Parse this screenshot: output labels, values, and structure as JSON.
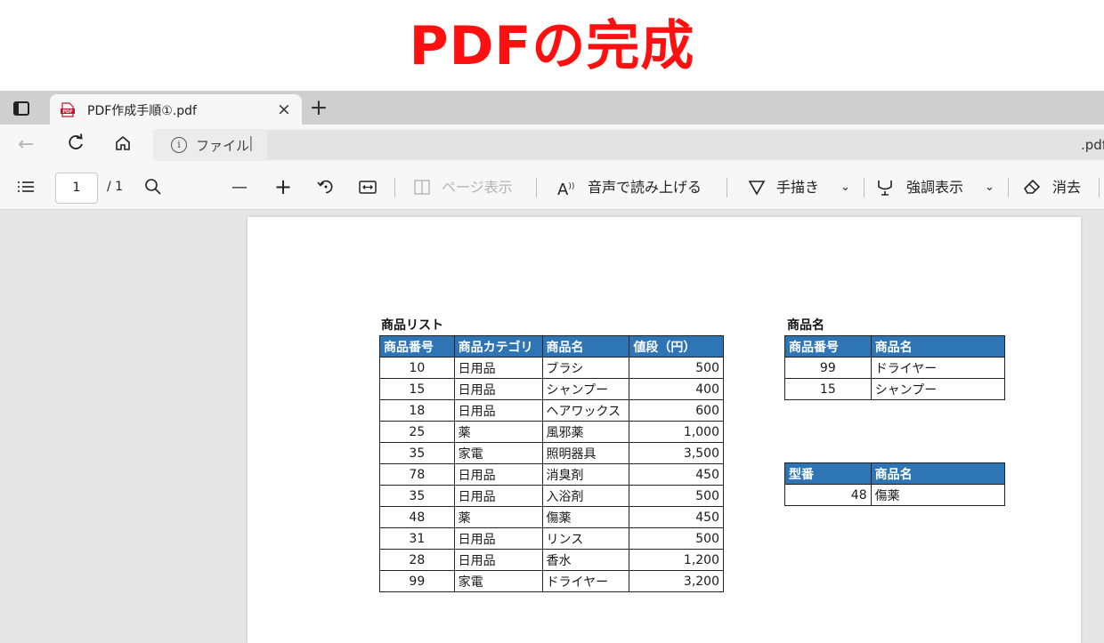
{
  "banner": {
    "title": "PDFの完成"
  },
  "tab": {
    "title": "PDF作成手順①.pdf",
    "close": "×",
    "new_tab": "+"
  },
  "address": {
    "scheme_label": "ファイル",
    "separator": "|",
    "tail": ".pdf"
  },
  "toolbar": {
    "page_current": "1",
    "page_total": "/ 1",
    "zoom_out": "—",
    "zoom_in": "+",
    "page_view": "ページ表示",
    "read_aloud": "音声で読み上げる",
    "draw": "手描き",
    "highlight": "強調表示",
    "erase": "消去",
    "chevron": "⌄"
  },
  "list_table": {
    "title": "商品リスト",
    "headers": [
      "商品番号",
      "商品カテゴリ",
      "商品名",
      "値段（円）"
    ],
    "rows": [
      [
        "10",
        "日用品",
        "ブラシ",
        "500"
      ],
      [
        "15",
        "日用品",
        "シャンプー",
        "400"
      ],
      [
        "18",
        "日用品",
        "ヘアワックス",
        "600"
      ],
      [
        "25",
        "薬",
        "風邪薬",
        "1,000"
      ],
      [
        "35",
        "家電",
        "照明器具",
        "3,500"
      ],
      [
        "78",
        "日用品",
        "消臭剤",
        "450"
      ],
      [
        "35",
        "日用品",
        "入浴剤",
        "500"
      ],
      [
        "48",
        "薬",
        "傷薬",
        "450"
      ],
      [
        "31",
        "日用品",
        "リンス",
        "500"
      ],
      [
        "28",
        "日用品",
        "香水",
        "1,200"
      ],
      [
        "99",
        "家電",
        "ドライヤー",
        "3,200"
      ]
    ]
  },
  "name_table": {
    "title": "商品名",
    "headers": [
      "商品番号",
      "商品名"
    ],
    "rows": [
      [
        "99",
        "ドライヤー"
      ],
      [
        "15",
        "シャンプー"
      ]
    ]
  },
  "model_table": {
    "headers": [
      "型番",
      "商品名"
    ],
    "rows": [
      [
        "48",
        "傷薬"
      ]
    ]
  },
  "colors": {
    "banner_red": "#ff1010",
    "header_blue": "#2e75b6"
  }
}
